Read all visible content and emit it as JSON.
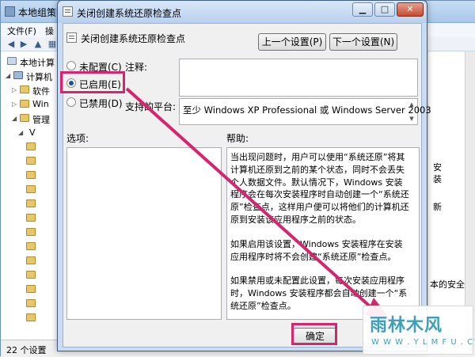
{
  "background_window": {
    "title": "本地组策略",
    "menu": [
      "文件(F)",
      "操"
    ],
    "tree_items": [
      "本地计算",
      "计算机",
      "软件",
      "Win",
      "管理",
      "V"
    ],
    "right_fragments": [
      "安",
      "装",
      "新",
      "本的安全"
    ],
    "status": "22 个设置"
  },
  "dialog": {
    "title": "关闭创建系统还原检查点",
    "heading": "关闭创建系统还原检查点",
    "prev_button": "上一个设置(P)",
    "next_button": "下一个设置(N)",
    "radio_not_configured": "未配置(C)",
    "radio_enabled": "已启用(E)",
    "radio_disabled": "已禁用(D)",
    "selected": "已启用(E)",
    "comment_label": "注释:",
    "platform_label": "支持的平台:",
    "platform_value": "至少 Windows XP Professional 或 Windows Server 2003",
    "options_label": "选项:",
    "help_label": "帮助:",
    "help_paragraphs": [
      "当出现问题时，用户可以使用“系统还原”将其计算机还原到之前的某个状态，同时不会丢失个人数据文件。默认情况下，Windows 安装程序会在每次安装程序时自动创建一个“系统还原”检查点，这样用户便可以将他们的计算机还原到安装该应用程序之前的状态。",
      "如果启用该设置，Windows 安装程序在安装应用程序时将不会创建“系统还原”检查点。",
      "如果禁用或未配置此设置，每次安装应用程序时，Windows 安装程序都会自动创建一个“系统还原”检查点。"
    ],
    "ok_button": "确定"
  },
  "annotation_color": "#d6246e",
  "watermark": {
    "logo": "雨林木风",
    "url": "W W W . Y L M F U . C O M"
  }
}
